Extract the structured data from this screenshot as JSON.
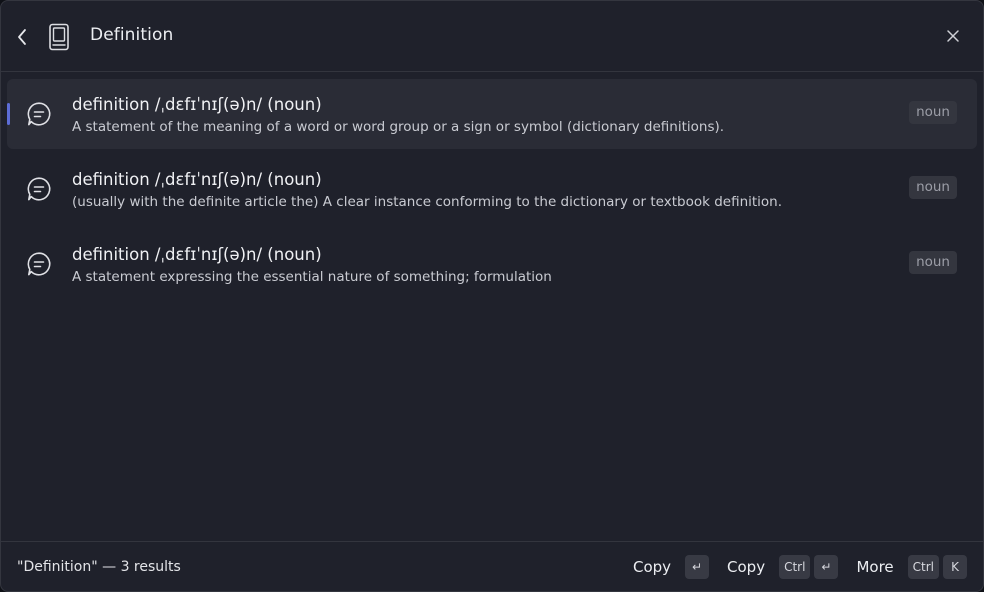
{
  "header": {
    "title": "Definition"
  },
  "results": [
    {
      "word": "definition  /ˌdɛfɪˈnɪʃ(ə)n/ (noun)",
      "description": "A statement of the meaning of a word or word group or a sign or symbol (dictionary definitions).",
      "tag": "noun",
      "selected": true
    },
    {
      "word": "definition  /ˌdɛfɪˈnɪʃ(ə)n/ (noun)",
      "description": "(usually with the definite article the) A clear instance conforming to the dictionary or textbook definition.",
      "tag": "noun",
      "selected": false
    },
    {
      "word": "definition  /ˌdɛfɪˈnɪʃ(ə)n/ (noun)",
      "description": "A statement expressing the essential nature of something; formulation",
      "tag": "noun",
      "selected": false
    }
  ],
  "footer": {
    "status": "\"Definition\" — 3 results",
    "actions": [
      {
        "label": "Copy",
        "keys": [
          "↵"
        ]
      },
      {
        "label": "Copy",
        "keys": [
          "Ctrl",
          "↵"
        ]
      },
      {
        "label": "More",
        "keys": [
          "Ctrl",
          "K"
        ]
      }
    ]
  },
  "icons": {
    "back": "chevron-left-icon",
    "book": "book-icon",
    "close": "close-icon",
    "result": "chat-bubble-icon"
  },
  "colors": {
    "background": "#1f212b",
    "selected_row": "#2a2c36",
    "accent": "#5d6dd6",
    "tag_bg": "#34363f",
    "key_bg": "#383a44"
  }
}
